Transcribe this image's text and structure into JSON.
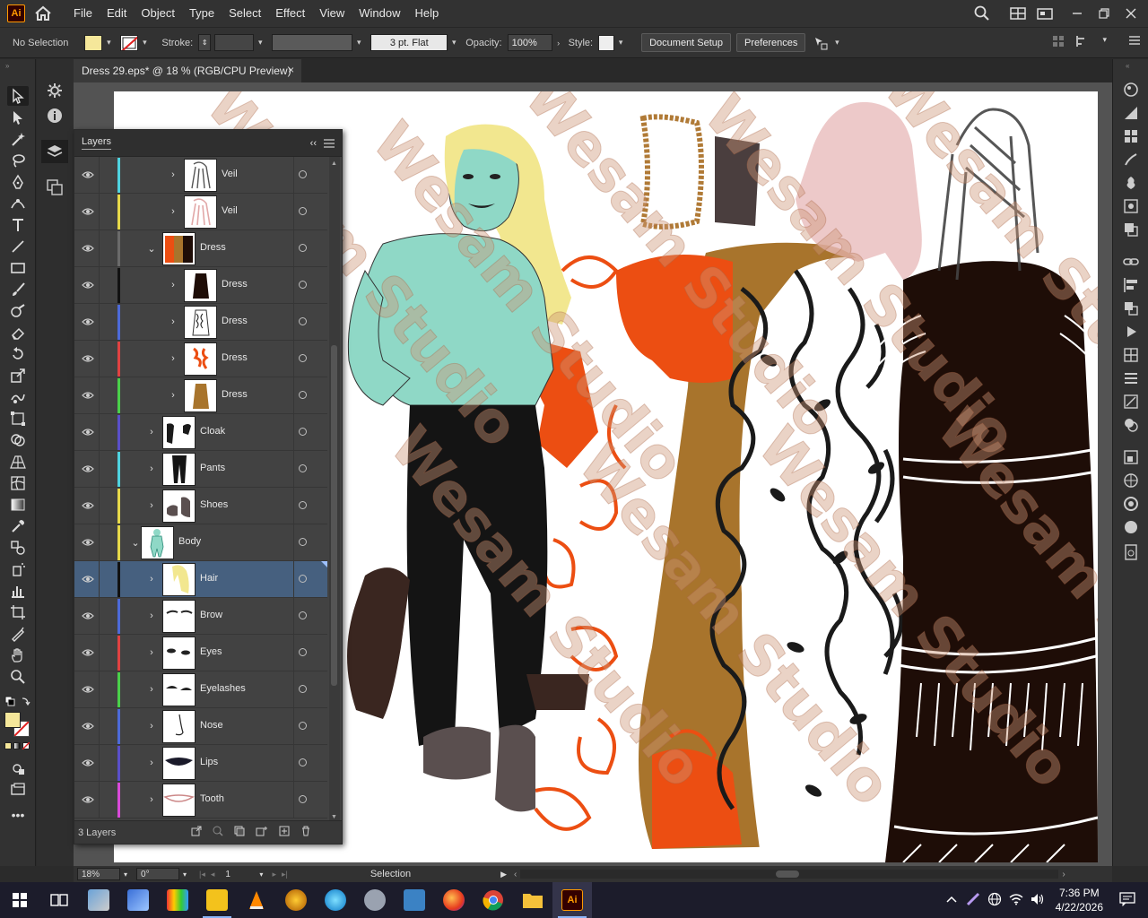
{
  "menubar": {
    "logo": "Ai",
    "items": [
      "File",
      "Edit",
      "Object",
      "Type",
      "Select",
      "Effect",
      "View",
      "Window",
      "Help"
    ]
  },
  "controlbar": {
    "selection": "No Selection",
    "fill_color": "#f5e79a",
    "stroke_label": "Stroke:",
    "brush": "3 pt. Flat",
    "opacity_label": "Opacity:",
    "opacity_value": "100%",
    "style_label": "Style:",
    "document_setup": "Document Setup",
    "preferences": "Preferences"
  },
  "document": {
    "tab_title": "Dress 29.eps* @ 18 % (RGB/CPU Preview)",
    "close": "×"
  },
  "layers_panel": {
    "title": "Layers",
    "footer_count": "3 Layers",
    "rows": [
      {
        "name": "Veil",
        "color": "#4fd3e0",
        "indent": 2,
        "expanded": false,
        "thumb": "veil-white"
      },
      {
        "name": "Veil",
        "color": "#e6d84a",
        "indent": 2,
        "expanded": false,
        "thumb": "veil-pink"
      },
      {
        "name": "Dress",
        "color": "#6a6a6a",
        "indent": 1,
        "expanded": true,
        "thumb": "dress-group"
      },
      {
        "name": "Dress",
        "color": "#111111",
        "indent": 2,
        "expanded": false,
        "thumb": "dress-black"
      },
      {
        "name": "Dress",
        "color": "#4d6ad8",
        "indent": 2,
        "expanded": false,
        "thumb": "dress-lace"
      },
      {
        "name": "Dress",
        "color": "#e04242",
        "indent": 2,
        "expanded": false,
        "thumb": "dress-orange"
      },
      {
        "name": "Dress",
        "color": "#4ad04a",
        "indent": 2,
        "expanded": false,
        "thumb": "dress-brown"
      },
      {
        "name": "Cloak",
        "color": "#5a4fc8",
        "indent": 1,
        "expanded": false,
        "thumb": "cloak"
      },
      {
        "name": "Pants",
        "color": "#4fd3e0",
        "indent": 1,
        "expanded": false,
        "thumb": "pants"
      },
      {
        "name": "Shoes",
        "color": "#e6d84a",
        "indent": 1,
        "expanded": false,
        "thumb": "shoes"
      },
      {
        "name": "Body",
        "color": "#e6d84a",
        "indent": 0,
        "expanded": true,
        "thumb": "body"
      },
      {
        "name": "Hair",
        "color": "#111111",
        "indent": 1,
        "expanded": false,
        "thumb": "hair",
        "selected": true
      },
      {
        "name": "Brow",
        "color": "#4d6ad8",
        "indent": 1,
        "expanded": false,
        "thumb": "brow"
      },
      {
        "name": "Eyes",
        "color": "#e04242",
        "indent": 1,
        "expanded": false,
        "thumb": "eyes"
      },
      {
        "name": "Eyelashes",
        "color": "#4ad04a",
        "indent": 1,
        "expanded": false,
        "thumb": "eyelashes"
      },
      {
        "name": "Nose",
        "color": "#4d6ad8",
        "indent": 1,
        "expanded": false,
        "thumb": "nose"
      },
      {
        "name": "Lips",
        "color": "#5a4fc8",
        "indent": 1,
        "expanded": false,
        "thumb": "lips"
      },
      {
        "name": "Tooth",
        "color": "#d84ad8",
        "indent": 1,
        "expanded": false,
        "thumb": "tooth"
      }
    ]
  },
  "statusbar": {
    "zoom": "18%",
    "rotation": "0°",
    "artboard": "1",
    "tool": "Selection"
  },
  "artboard": {
    "watermark_text": "Wesam Studio"
  },
  "taskbar": {
    "time": "7:36 PM",
    "date": "4/22/2026"
  },
  "colors": {
    "skin": "#8fd8c6",
    "hair": "#f2e78f",
    "orange": "#ec4e12",
    "brown_dress": "#a8742c",
    "dark_dress": "#1e0d07",
    "pants": "#141414",
    "boots": "#3a2620"
  }
}
